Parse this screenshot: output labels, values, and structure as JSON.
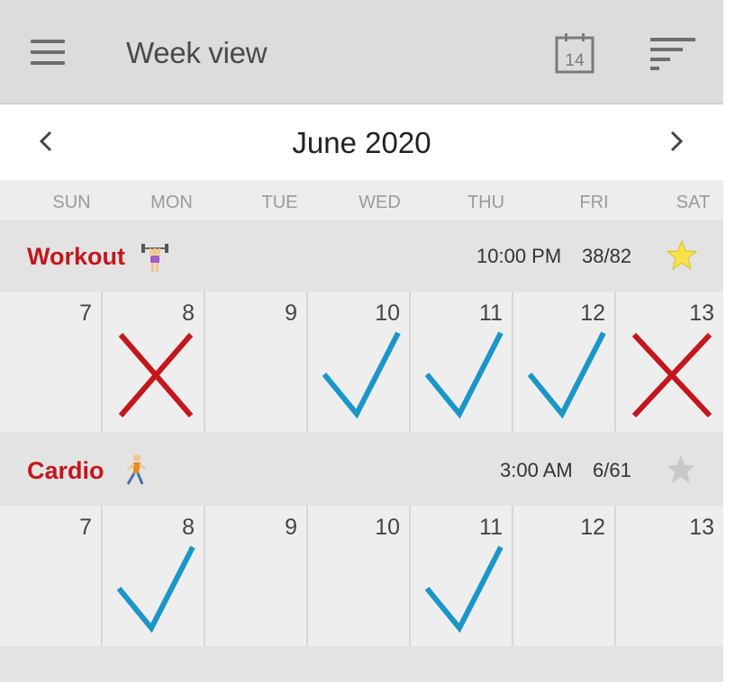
{
  "appbar": {
    "title": "Week view",
    "calendar_icon_number": "14"
  },
  "month": {
    "label": "June 2020"
  },
  "weekdays": [
    "SUN",
    "MON",
    "TUE",
    "WED",
    "THU",
    "FRI",
    "SAT"
  ],
  "habits": [
    {
      "name": "Workout",
      "emoji": "weightlifting-woman-icon",
      "time": "10:00 PM",
      "count": "38/82",
      "starred": true,
      "days": [
        {
          "num": "7",
          "mark": "none"
        },
        {
          "num": "8",
          "mark": "cross"
        },
        {
          "num": "9",
          "mark": "none"
        },
        {
          "num": "10",
          "mark": "check"
        },
        {
          "num": "11",
          "mark": "check"
        },
        {
          "num": "12",
          "mark": "check"
        },
        {
          "num": "13",
          "mark": "cross"
        }
      ]
    },
    {
      "name": "Cardio",
      "emoji": "running-man-icon",
      "time": "3:00 AM",
      "count": "6/61",
      "starred": false,
      "days": [
        {
          "num": "7",
          "mark": "none"
        },
        {
          "num": "8",
          "mark": "check"
        },
        {
          "num": "9",
          "mark": "none"
        },
        {
          "num": "10",
          "mark": "none"
        },
        {
          "num": "11",
          "mark": "check"
        },
        {
          "num": "12",
          "mark": "none"
        },
        {
          "num": "13",
          "mark": "none"
        }
      ]
    }
  ],
  "colors": {
    "habit_name": "#c4161c",
    "check": "#1b96c8",
    "cross": "#c4161c",
    "star_on": "#f7e24a",
    "star_off": "#c9c9c9"
  }
}
